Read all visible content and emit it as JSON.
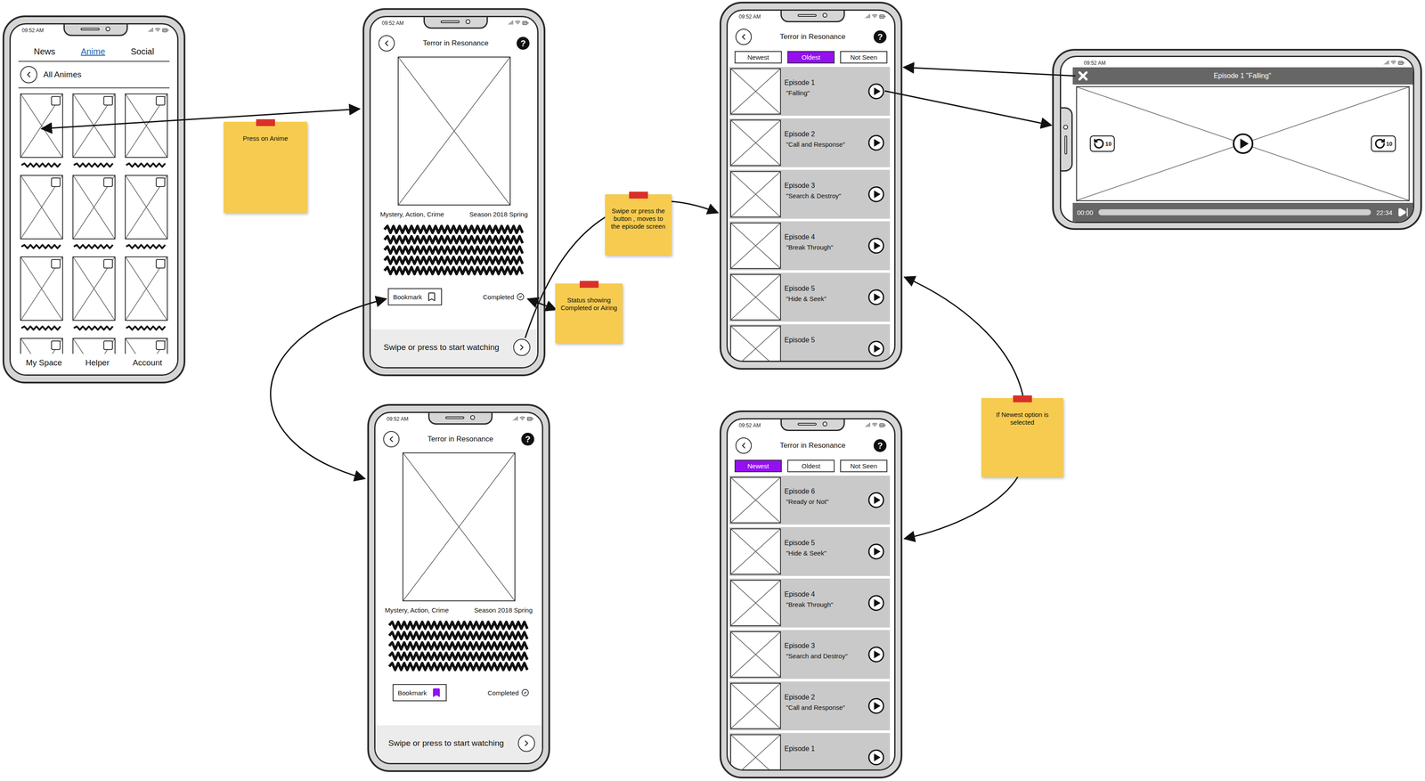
{
  "status_time": "09:52 AM",
  "anime_list": {
    "tabs": [
      {
        "label": "News",
        "selected": false
      },
      {
        "label": "Anime",
        "selected": true
      },
      {
        "label": "Social",
        "selected": false
      }
    ],
    "back_label": "All Animes",
    "tiles": [
      {
        "kind": "anime"
      },
      {
        "kind": "anime"
      },
      {
        "kind": "anime"
      },
      {
        "kind": "anime"
      },
      {
        "kind": "anime"
      },
      {
        "kind": "anime"
      },
      {
        "kind": "anime"
      },
      {
        "kind": "anime"
      },
      {
        "kind": "anime"
      },
      {
        "kind": "anime"
      },
      {
        "kind": "anime"
      },
      {
        "kind": "anime"
      }
    ],
    "nav": [
      {
        "label": "My Space",
        "selected": false
      },
      {
        "label": "Helper",
        "selected": false
      },
      {
        "label": "Account",
        "selected": false
      }
    ]
  },
  "details": [
    {
      "title": "Terror in Resonance",
      "help": "?",
      "genres": "Mystery, Action, Crime",
      "season": "Season 2018 Spring",
      "bookmark_label": "Bookmark",
      "bookmarked": false,
      "status": "Completed",
      "cta": "Swipe or press to start watching"
    },
    {
      "title": "Terror in Resonance",
      "help": "?",
      "genres": "Mystery, Action, Crime",
      "season": "Season 2018 Spring",
      "bookmark_label": "Bookmark",
      "bookmarked": true,
      "status": "Completed",
      "cta": "Swipe or press to start watching"
    }
  ],
  "episode_lists": [
    {
      "title": "Terror in Resonance",
      "help": "?",
      "filters": [
        {
          "label": "Newest",
          "selected": false
        },
        {
          "label": "Oldest",
          "selected": true
        },
        {
          "label": "Not Seen",
          "selected": false
        }
      ],
      "episodes": [
        {
          "number": "Episode 1",
          "name": "\"Falling\""
        },
        {
          "number": "Episode 2",
          "name": "\"Call and Response\""
        },
        {
          "number": "Episode 3",
          "name": "\"Search & Destroy\""
        },
        {
          "number": "Episode 4",
          "name": "\"Break Through\""
        },
        {
          "number": "Episode 5",
          "name": "\"Hide & Seek\""
        },
        {
          "number": "Episode 5"
        }
      ]
    },
    {
      "title": "Terror in Resonance",
      "help": "?",
      "filters": [
        {
          "label": "Newest",
          "selected": true
        },
        {
          "label": "Oldest",
          "selected": false
        },
        {
          "label": "Not Seen",
          "selected": false
        }
      ],
      "episodes": [
        {
          "number": "Episode 6",
          "name": "\"Ready or Not\""
        },
        {
          "number": "Episode 5",
          "name": "\"Hide & Seek\""
        },
        {
          "number": "Episode 4",
          "name": "\"Break Through\""
        },
        {
          "number": "Episode 3",
          "name": "\"Search and Destroy\""
        },
        {
          "number": "Episode 2",
          "name": "\"Call and Response\""
        },
        {
          "number": "Episode 1"
        }
      ]
    }
  ],
  "player": {
    "title": "Episode 1 \"Falling\"",
    "rewind": "10",
    "forward": "10",
    "elapsed": "00:00",
    "duration": "22:34",
    "level": 0
  },
  "notes": [
    {
      "text": "Press on Anime"
    },
    {
      "text": "Swipe or press the button , moves to the episode screen"
    },
    {
      "text": "Status showing Completed or Airing"
    },
    {
      "text": "If Newest option is selected"
    }
  ]
}
